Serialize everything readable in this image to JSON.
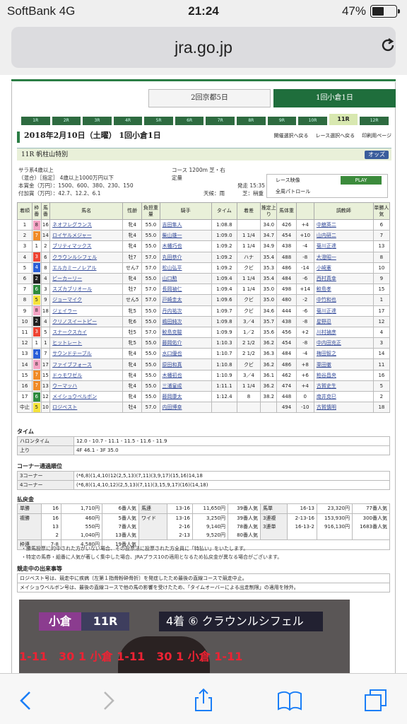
{
  "status_bar": {
    "carrier": "SoftBank  4G",
    "time": "21:24",
    "battery": "47%"
  },
  "browser": {
    "url": "jra.go.jp"
  },
  "meetings": [
    {
      "label": "2回京都5日",
      "active": false
    },
    {
      "label": "1回小倉1日",
      "active": true
    }
  ],
  "races": [
    "1R",
    "2R",
    "3R",
    "4R",
    "5R",
    "6R",
    "7R",
    "8R",
    "9R",
    "10R",
    "11R",
    "12R"
  ],
  "active_race": "11R",
  "header": {
    "date_title": "2018年2月10日（土曜） 1回小倉1日",
    "link1": "開催選択へ戻る",
    "link2": "レース選択へ戻る",
    "link3": "印刷用ページ"
  },
  "race_name": "11R 帆柱山特別",
  "odds_label": "オッズ",
  "info": {
    "line1": "サラ系4歳以上",
    "line2": "（混合）［指定］ 4歳以上1000万円以下",
    "prize": "本賞金（万円）：1500、600、380、230、150",
    "add_prize": "付加賞（万円）：42.7、12.2、6.1",
    "course": "コース 1200m 芝・右",
    "fixed": "定量",
    "start": "発走 15:35",
    "weather": "天候：雨",
    "going": "芝：稍重"
  },
  "video": {
    "label1": "レース映像",
    "play": "PLAY",
    "label2": "全周パトロール"
  },
  "results_headers": [
    "着順",
    "枠番",
    "馬番",
    "馬名",
    "性齢",
    "負担重量",
    "騎手",
    "タイム",
    "着差",
    "推定上り",
    "馬体重",
    "",
    "調教師",
    "単勝人気"
  ],
  "results": [
    [
      "1",
      "8",
      "16",
      "ネオフレグランス",
      "牝4",
      "55.0",
      "吉田隼人",
      "1:08.8",
      "",
      "34.0",
      "426",
      "+4",
      "中舘英二",
      "6"
    ],
    [
      "2",
      "7",
      "14",
      "ロイヤルメジャー",
      "牝4",
      "55.0",
      "柴山雄一",
      "1:09.0",
      "1 1/4",
      "34.7",
      "454",
      "+10",
      "山内研二",
      "7"
    ],
    [
      "3",
      "1",
      "2",
      "ブリティマックス",
      "牝4",
      "55.0",
      "木幡巧也",
      "1:09.2",
      "1 1/4",
      "34.9",
      "438",
      "-4",
      "菊川正達",
      "13"
    ],
    [
      "4",
      "3",
      "6",
      "クラウンルシフェル",
      "牡7",
      "57.0",
      "丸田恭介",
      "1:09.2",
      "ハナ",
      "35.4",
      "488",
      "-8",
      "大澄昭一",
      "8"
    ],
    [
      "5",
      "4",
      "8",
      "エルカミーノレアル",
      "せん7",
      "57.0",
      "松山弘平",
      "1:09.2",
      "クビ",
      "35.3",
      "486",
      "-14",
      "小崎憲",
      "10"
    ],
    [
      "6",
      "2",
      "4",
      "ビーカーリー",
      "牝4",
      "55.0",
      "山口勲",
      "1:09.4",
      "1 1/4",
      "35.4",
      "484",
      "-6",
      "西村真幸",
      "9"
    ],
    [
      "7",
      "6",
      "3",
      "スズカブリオール",
      "牡7",
      "57.0",
      "長岡禎仁",
      "1:09.4",
      "1 1/4",
      "35.0",
      "498",
      "+14",
      "鮫島孝",
      "15"
    ],
    [
      "8",
      "5",
      "9",
      "ジョーマイク",
      "せん5",
      "57.0",
      "戸崎圭太",
      "1:09.6",
      "クビ",
      "35.0",
      "480",
      "-2",
      "中竹和也",
      "1"
    ],
    [
      "9",
      "8",
      "18",
      "ジェイラー",
      "牝5",
      "55.0",
      "丹内祐次",
      "1:09.7",
      "クビ",
      "34.6",
      "444",
      "-6",
      "菊川正達",
      "17"
    ],
    [
      "10",
      "2",
      "4",
      "クリノスイートピー",
      "牝6",
      "55.0",
      "嶋田純次",
      "1:09.8",
      "3／4",
      "35.7",
      "438",
      "-8",
      "星野忍",
      "12"
    ],
    [
      "11",
      "3",
      "5",
      "スナークスカイ",
      "牡5",
      "57.0",
      "鮫島克駿",
      "1:09.9",
      "1／2",
      "35.6",
      "456",
      "+2",
      "川村禎彦",
      "4"
    ],
    [
      "12",
      "1",
      "1",
      "ヒットレート",
      "牝5",
      "55.0",
      "藤岡佑介",
      "1:10.3",
      "2 1/2",
      "36.2",
      "454",
      "-8",
      "中内田充正",
      "3"
    ],
    [
      "13",
      "4",
      "7",
      "サウンドテーブル",
      "牝4",
      "55.0",
      "水口優也",
      "1:10.7",
      "2 1/2",
      "36.3",
      "484",
      "-4",
      "梅田智之",
      "14"
    ],
    [
      "14",
      "8",
      "17",
      "ファイブフォース",
      "牝4",
      "55.0",
      "原田和真",
      "1:10.8",
      "クビ",
      "36.2",
      "486",
      "+8",
      "栗田徹",
      "11"
    ],
    [
      "15",
      "7",
      "15",
      "ドゥモワゼル",
      "牝4",
      "55.0",
      "木幡初也",
      "1:10.9",
      "3／4",
      "36.1",
      "462",
      "+6",
      "粕谷昌央",
      "16"
    ],
    [
      "16",
      "7",
      "13",
      "ウーマッハ",
      "牝4",
      "55.0",
      "三浦皇成",
      "1:11.1",
      "1 1/4",
      "36.2",
      "474",
      "+4",
      "古賀史生",
      "5"
    ],
    [
      "17",
      "6",
      "12",
      "メイショウベルボン",
      "牝4",
      "55.0",
      "藤岡康太",
      "1:12.4",
      "8",
      "38.2",
      "448",
      "0",
      "南井克巳",
      "2"
    ],
    [
      "中止",
      "5",
      "10",
      "ロジベスト",
      "牡4",
      "57.0",
      "内田博幸",
      "",
      "",
      "",
      "494",
      "-10",
      "古賀慎明",
      "18"
    ]
  ],
  "time_section": {
    "title": "タイム",
    "halon_label": "ハロンタイム",
    "halon": "12.0 - 10.7 - 11.1 - 11.5 - 11.6 - 11.9",
    "agari_label": "上り",
    "agari": "4F 46.1 - 3F 35.0"
  },
  "corner_section": {
    "title": "コーナー通過順位",
    "c3_label": "3コーナー",
    "c3": "(*6,8)(1,4,10)12(2,5,13)(7,11)(3,9,17)(15,16)14,18",
    "c4_label": "4コーナー",
    "c4": "(*6,8)(1,4,10,12)(2,5,13)(7,11)(3,15,9,17)(16)(14,18)"
  },
  "payout_section": {
    "title": "払戻金"
  },
  "payouts": {
    "tansho": {
      "label": "単勝",
      "num": "16",
      "amount": "1,710円",
      "pop": "6番人気"
    },
    "fukusho": {
      "label": "複勝",
      "nums": [
        "16",
        "13",
        "2"
      ],
      "amounts": [
        "460円",
        "550円",
        "1,040円"
      ],
      "pops": [
        "5番人気",
        "7番人気",
        "13番人気"
      ]
    },
    "wakuren": {
      "label": "枠連",
      "num": "7-8",
      "amount": "4,580円",
      "pop": "19番人気"
    },
    "umaren": {
      "label": "馬連",
      "num": "13-16",
      "amount": "11,650円",
      "pop": "39番人気"
    },
    "wide": {
      "label": "ワイド",
      "nums": [
        "13-16",
        "2-16",
        "2-13"
      ],
      "amounts": [
        "3,250円",
        "9,140円",
        "9,520円"
      ],
      "pops": [
        "39番人気",
        "78番人気",
        "80番人気"
      ]
    },
    "umatan": {
      "label": "馬単",
      "num": "16-13",
      "amount": "23,320円",
      "pop": "77番人気"
    },
    "sanrenpuku": {
      "label": "3連複",
      "num": "2-13-16",
      "amount": "153,930円",
      "pop": "300番人気"
    },
    "sanrentan": {
      "label": "3連単",
      "num": "16-13-2",
      "amount": "916,130円",
      "pop": "1683番人気"
    }
  },
  "notes": [
    "・勝馬投票に的中された方がいない場合、その投票法に投票された方全員に「特払い」をいたします。",
    "・特定の馬券・組番に人気が著しく集中した場合、JRAプラス10の適用となるため払戻金が異なる場合がございます。"
  ],
  "incidents": {
    "title": "競走中の出来事等",
    "line1": "ロジベスト号は、競走中に疾病〔左第１指骨粉砕骨折〕を発症したため最後の直線コースで競走中止。",
    "line2": "メイショウベルボン号は、最後の直線コースで他の馬の影響を受けたため、「タイムオーバーによる出走制限」の適用を除外。"
  },
  "video_frame": {
    "place": "小倉",
    "race": "11R",
    "caption": "4着 ⑥ クラウンルシフェル",
    "rail": "1-11　30 1 小倉 1-11　30 1 小倉 1-11"
  },
  "colors": {
    "accent_green": "#2b7d45",
    "table_header_bg": "#e9f0d9",
    "link_blue": "#334a99"
  }
}
